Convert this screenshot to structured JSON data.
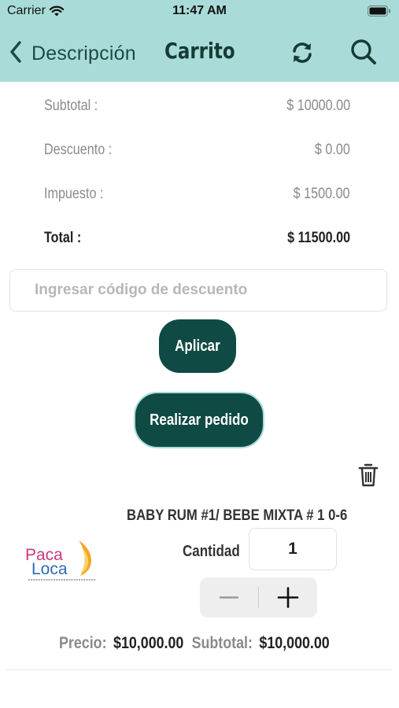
{
  "status_bar": {
    "carrier": "Carrier",
    "time": "11:47 AM"
  },
  "nav": {
    "back_label": "Descripción",
    "title": "Carrito",
    "accent": "#a9dcd8"
  },
  "summary": {
    "subtotal": {
      "label": "Subtotal :",
      "value": "$ 10000.00"
    },
    "discount": {
      "label": "Descuento :",
      "value": "$ 0.00"
    },
    "tax": {
      "label": "Impuesto :",
      "value": "$ 1500.00"
    },
    "total": {
      "label": "Total :",
      "value": "$ 11500.00"
    }
  },
  "discount_code": {
    "placeholder": "Ingresar código de descuento",
    "value": ""
  },
  "buttons": {
    "apply": "Aplicar",
    "place_order": "Realizar pedido",
    "color": "#0f4a44"
  },
  "cart_item": {
    "name": "BABY RUM #1/ BEBE MIXTA  # 1   0-6",
    "logo_text": "Paca Loca",
    "quantity_label": "Cantidad",
    "quantity": "1",
    "price_label": "Precio:",
    "price": "$10,000.00",
    "subtotal_label": "Subtotal:",
    "subtotal": "$10,000.00"
  }
}
